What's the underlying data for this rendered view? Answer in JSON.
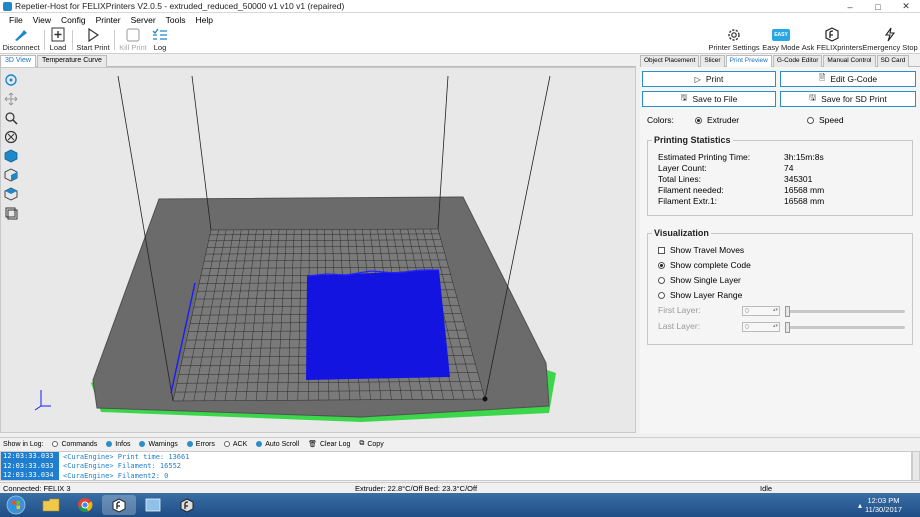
{
  "window": {
    "title": "Repetier-Host for FELIXPrinters V2.0.5 - extruded_reduced_50000 v1 v10 v1 (repaired)",
    "minimize": "–",
    "maximize": "□",
    "close": "✕"
  },
  "menu": [
    "File",
    "View",
    "Config",
    "Printer",
    "Server",
    "Tools",
    "Help"
  ],
  "toolbar": {
    "disconnect": "Disconnect",
    "load": "Load",
    "start_print": "Start Print",
    "kill_print": "Kill Print",
    "log": "Log",
    "printer_settings": "Printer Settings",
    "easy_mode": "Easy Mode",
    "easy_badge": "EASY",
    "ask_felix": "Ask FELIXprinters",
    "emergency_stop": "Emergency Stop"
  },
  "left_tabs": [
    "3D View",
    "Temperature Curve"
  ],
  "right_tabs": [
    "Object Placement",
    "Slicer",
    "Print Preview",
    "G-Code Editor",
    "Manual Control",
    "SD Card"
  ],
  "print_preview": {
    "print_btn": "Print",
    "edit_gcode_btn": "Edit G-Code",
    "save_file_btn": "Save to File",
    "save_sd_btn": "Save for SD Print",
    "colors_label": "Colors:",
    "color_extruder": "Extruder",
    "color_speed": "Speed",
    "stats_title": "Printing Statistics",
    "stats": [
      {
        "label": "Estimated Printing Time:",
        "value": "3h:15m:8s"
      },
      {
        "label": "Layer Count:",
        "value": "74"
      },
      {
        "label": "Total Lines:",
        "value": "345301"
      },
      {
        "label": "Filament needed:",
        "value": "16568 mm"
      },
      {
        "label": "Filament Extr.1:",
        "value": "16568 mm"
      }
    ],
    "vis_title": "Visualization",
    "show_travel": "Show Travel Moves",
    "show_complete": "Show complete Code",
    "show_single": "Show Single Layer",
    "show_range": "Show Layer Range",
    "first_layer_label": "First Layer:",
    "last_layer_label": "Last Layer:",
    "first_layer_value": "0",
    "last_layer_value": "0"
  },
  "log_toolbar": {
    "show_in_log": "Show in Log:",
    "commands": "Commands",
    "infos": "Infos",
    "warnings": "Warnings",
    "errors": "Errors",
    "ack": "ACK",
    "auto_scroll": "Auto Scroll",
    "clear_log": "Clear Log",
    "copy": "Copy"
  },
  "log_lines": [
    {
      "ts": "12:03:33.033",
      "msg": "<CuraEngine> Print time: 13661"
    },
    {
      "ts": "12:03:33.033",
      "msg": "<CuraEngine> Filament: 16552"
    },
    {
      "ts": "12:03:33.034",
      "msg": "<CuraEngine> Filament2: 0"
    }
  ],
  "status": {
    "connection": "Connected: FELIX 3",
    "temps": "Extruder: 22.8°C/Off Bed: 23.3°C/Off",
    "state": "Idle"
  },
  "taskbar": {
    "time": "12:03 PM",
    "date": "11/30/2017"
  },
  "colors": {
    "accent": "#1a73c8",
    "print_model": "#1414e0",
    "bed": "#6b6b6b",
    "button_border": "#2c8ec9"
  }
}
